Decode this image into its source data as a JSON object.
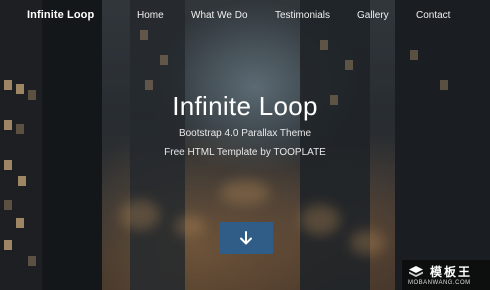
{
  "nav": {
    "brand": "Infinite Loop",
    "items": [
      {
        "label": "Home"
      },
      {
        "label": "What We Do"
      },
      {
        "label": "Testimonials"
      },
      {
        "label": "Gallery"
      },
      {
        "label": "Contact"
      }
    ]
  },
  "hero": {
    "title": "Infinite Loop",
    "subtitle_line1": "Bootstrap 4.0 Parallax Theme",
    "subtitle_line2": "Free HTML Template by TOOPLATE",
    "scroll_button_icon": "arrow-down-icon",
    "scroll_button_color": "#2f5d88"
  },
  "watermark": {
    "cn_text": "模板王",
    "en_text": "MOBANWANG.COM"
  }
}
